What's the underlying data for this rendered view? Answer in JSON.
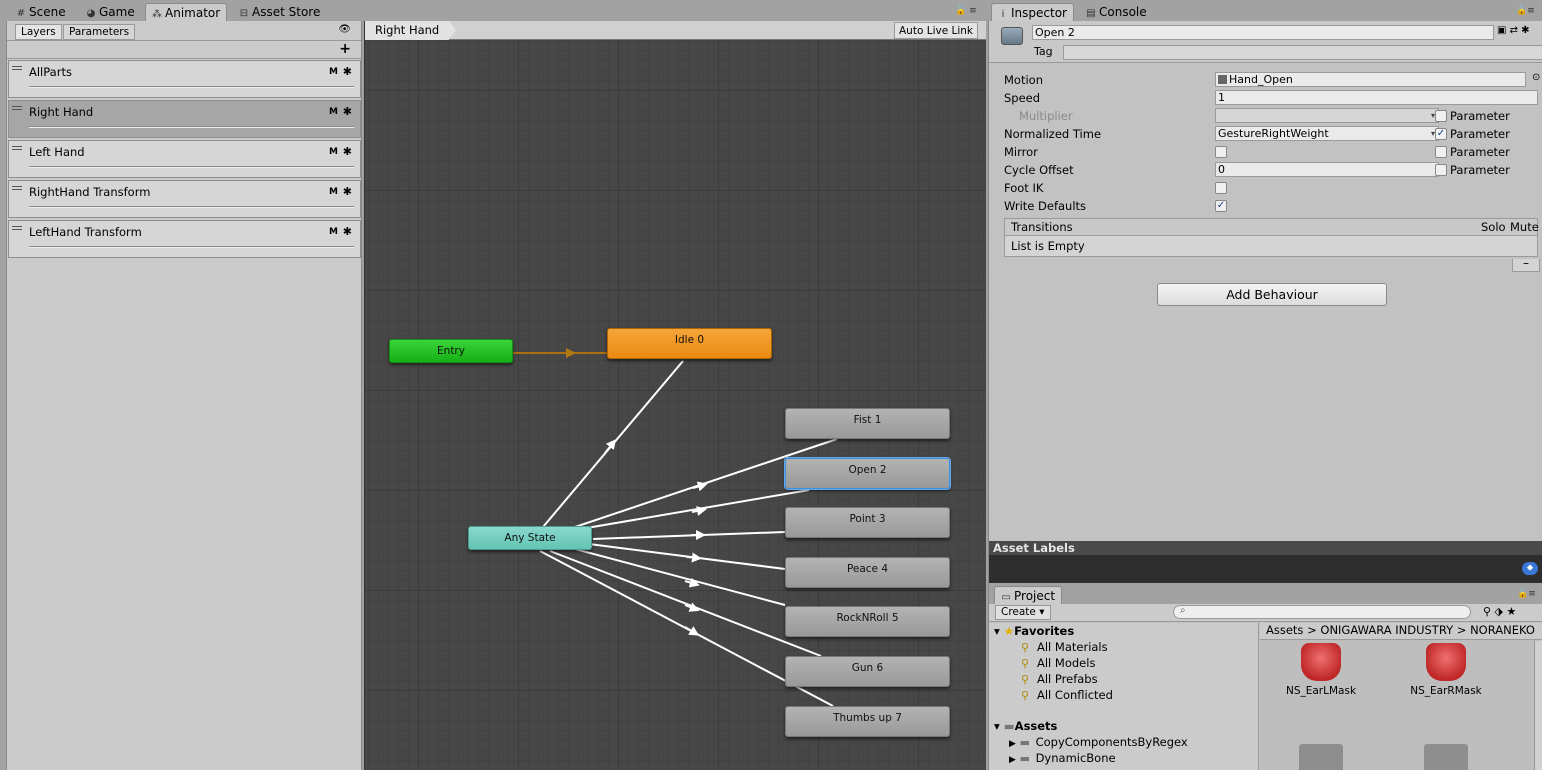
{
  "main_tabs": [
    {
      "icon": "#",
      "label": "Scene"
    },
    {
      "icon": "◕",
      "label": "Game"
    },
    {
      "icon": "⁂",
      "label": "Animator"
    },
    {
      "icon": "⊟",
      "label": "Asset Store"
    }
  ],
  "right_tabs": [
    {
      "icon": "i",
      "label": "Inspector"
    },
    {
      "icon": "▤",
      "label": "Console"
    }
  ],
  "left_panel": {
    "tabs": [
      "Layers",
      "Parameters"
    ],
    "add": "+",
    "eye": "👁",
    "layers": [
      {
        "name": "AllParts",
        "m": "M",
        "gear": "✱"
      },
      {
        "name": "Right Hand",
        "m": "M",
        "gear": "✱"
      },
      {
        "name": "Left Hand",
        "m": "M",
        "gear": "✱"
      },
      {
        "name": "RightHand Transform",
        "m": "M",
        "gear": "✱"
      },
      {
        "name": "LeftHand Transform",
        "m": "M",
        "gear": "✱"
      }
    ]
  },
  "graph": {
    "breadcrumb": "Right Hand",
    "auto_live_link": "Auto Live Link",
    "nodes": {
      "entry": "Entry",
      "idle": "Idle 0",
      "any": "Any State",
      "states": [
        "Fist 1",
        "Open 2",
        "Point 3",
        "Peace 4",
        "RockNRoll 5",
        "Gun 6",
        "Thumbs up 7"
      ]
    },
    "colors": {
      "entry": "#22c022",
      "default_state": "#ef8f15",
      "any_state": "#74cfc0",
      "selected": "#3b8ee0"
    }
  },
  "inspector": {
    "name": "Open 2",
    "tag_label": "Tag",
    "props": {
      "motion_label": "Motion",
      "motion_value": "Hand_Open",
      "speed_label": "Speed",
      "speed_value": "1",
      "multiplier_label": "Multiplier",
      "normalized_label": "Normalized Time",
      "normalized_value": "GestureRightWeight",
      "mirror_label": "Mirror",
      "cycle_label": "Cycle Offset",
      "cycle_value": "0",
      "footik_label": "Foot IK",
      "writedef_label": "Write Defaults",
      "parameter": "Parameter"
    },
    "checks": {
      "multiplier_param": false,
      "normalized_param": true,
      "mirror": false,
      "mirror_param": false,
      "cycle_param": false,
      "foot_ik": false,
      "write_defaults": true
    },
    "transitions": {
      "header": "Transitions",
      "solo": "Solo",
      "mute": "Mute",
      "empty": "List is Empty",
      "minus": "–"
    },
    "add_behaviour": "Add Behaviour"
  },
  "asset_labels": {
    "title": "Asset Labels"
  },
  "project": {
    "tab": "Project",
    "create": "Create ▾",
    "favorites": {
      "label": "Favorites",
      "items": [
        "All Materials",
        "All Models",
        "All Prefabs",
        "All Conflicted"
      ]
    },
    "assets": {
      "label": "Assets",
      "items": [
        "CopyComponentsByRegex",
        "DynamicBone"
      ]
    },
    "crumbs": [
      "Assets",
      "ONIGAWARA INDUSTRY",
      "NORANEKO"
    ],
    "grid": [
      "NS_EarLMask",
      "NS_EarRMask"
    ]
  }
}
